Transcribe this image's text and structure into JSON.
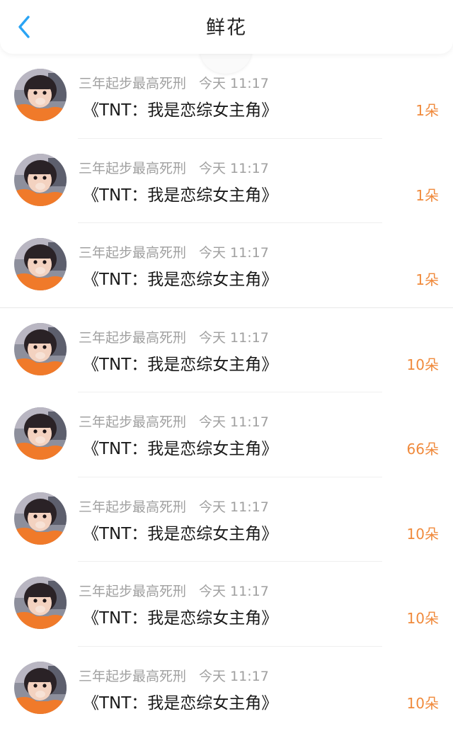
{
  "header": {
    "title": "鲜花",
    "back_icon": "chevron-left-icon",
    "accent_color": "#2aa4f4"
  },
  "count_color": "#f08a3c",
  "items": [
    {
      "user": "三年起步最高死刑",
      "time": "今天 11:17",
      "book": "《TNT：我是恋综女主角》",
      "count": "1朵"
    },
    {
      "user": "三年起步最高死刑",
      "time": "今天 11:17",
      "book": "《TNT：我是恋综女主角》",
      "count": "1朵"
    },
    {
      "user": "三年起步最高死刑",
      "time": "今天 11:17",
      "book": "《TNT：我是恋综女主角》",
      "count": "1朵"
    },
    {
      "user": "三年起步最高死刑",
      "time": "今天 11:17",
      "book": "《TNT：我是恋综女主角》",
      "count": "10朵"
    },
    {
      "user": "三年起步最高死刑",
      "time": "今天 11:17",
      "book": "《TNT：我是恋综女主角》",
      "count": "66朵"
    },
    {
      "user": "三年起步最高死刑",
      "time": "今天 11:17",
      "book": "《TNT：我是恋综女主角》",
      "count": "10朵"
    },
    {
      "user": "三年起步最高死刑",
      "time": "今天 11:17",
      "book": "《TNT：我是恋综女主角》",
      "count": "10朵"
    },
    {
      "user": "三年起步最高死刑",
      "time": "今天 11:17",
      "book": "《TNT：我是恋综女主角》",
      "count": "10朵"
    }
  ]
}
